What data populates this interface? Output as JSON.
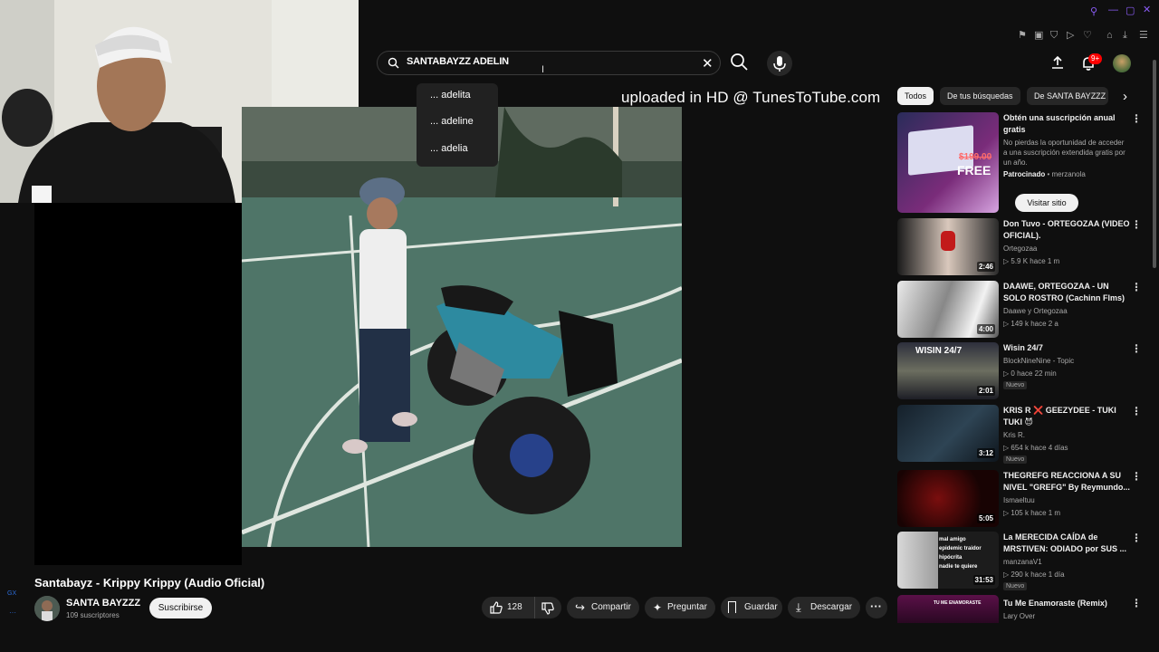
{
  "search": {
    "query": "SANTABAYZZ ADELIN"
  },
  "suggestions": [
    "... adelita",
    "... adeline",
    "... adelia"
  ],
  "overlay_caption": "uploaded in HD @ TunesToTube.com",
  "video": {
    "title": "Santabayz - Krippy Krippy (Audio Oficial)",
    "channel": "SANTA BAYZZZ",
    "subscribers": "109 suscriptores",
    "subscribe_label": "Suscribirse",
    "likes": "128",
    "share_label": "Compartir",
    "ask_label": "Preguntar",
    "save_label": "Guardar",
    "download_label": "Descargar"
  },
  "header": {
    "notifications": "9+"
  },
  "chips": [
    "Todos",
    "De tus búsquedas",
    "De SANTA BAYZZZ"
  ],
  "ad": {
    "title": "Obtén una suscripción anual gratis",
    "description": "No pierdas la oportunidad de acceder a una suscripción extendida gratis por un año.",
    "sponsored": "Patrocinado",
    "advertiser": "merzanola",
    "cta": "Visitar sitio",
    "thumb_text": "FREE",
    "thumb_price": "$199.00"
  },
  "recommendations": [
    {
      "title": "Don Tuvo - ORTEGOZAA (VIDEO OFICIAL).",
      "channel": "Ortegozaa",
      "views": "5.9 K",
      "age": "hace 1 m",
      "duration": "2:46",
      "badge": ""
    },
    {
      "title": "DAAWE, ORTEGOZAA - UN SOLO ROSTRO (Cachinn Flms)",
      "channel": "Daawe y Ortegozaa",
      "views": "149 k",
      "age": "hace 2 a",
      "duration": "4:00",
      "badge": ""
    },
    {
      "title": "Wisin 24/7",
      "channel": "BlockNineNine - Topic",
      "views": "0",
      "age": "hace 22 min",
      "duration": "2:01",
      "badge": "Nuevo",
      "thumb_text": "WISIN 24/7"
    },
    {
      "title": "KRIS R ❌ GEEZYDEE - TUKI TUKI 😈",
      "channel": "Kris R.",
      "views": "654 k",
      "age": "hace 4 días",
      "duration": "3:12",
      "badge": "Nuevo"
    },
    {
      "title": "THEGREFG REACCIONA A SU NIVEL \"GREFG\" By Reymundo...",
      "channel": "Ismaeltuu",
      "views": "105 k",
      "age": "hace 1 m",
      "duration": "5:05",
      "badge": ""
    },
    {
      "title": "La MERECIDA CAÍDA de MRSTIVEN: ODIADO por SUS ...",
      "channel": "manzanaV1",
      "views": "290 k",
      "age": "hace 1 día",
      "duration": "31:53",
      "badge": "Nuevo",
      "thumb_lines": [
        "mal amigo",
        "epidemic traidor",
        "hipócrita",
        "nadie te quiere"
      ]
    },
    {
      "title": "Tu Me Enamoraste (Remix)",
      "channel": "Lary Over",
      "views": "",
      "age": "",
      "duration": "",
      "badge": "",
      "thumb_text": "TU ME ENAMORASTE"
    }
  ],
  "colors": {
    "background": "#0f0f0f",
    "accent_red": "#ff0000",
    "chip_active": "#f1f1f1"
  }
}
